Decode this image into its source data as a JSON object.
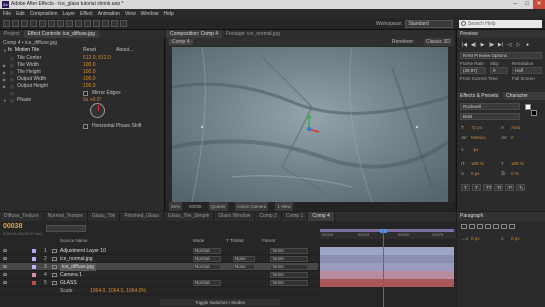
{
  "window": {
    "title": "Adobe After Effects - Ice_glass tutorial shrink.aep *",
    "app_icon": "Ae"
  },
  "menu": [
    "File",
    "Edit",
    "Composition",
    "Layer",
    "Effect",
    "Animation",
    "View",
    "Window",
    "Help"
  ],
  "toolbar": {
    "workspace_label": "Workspace:",
    "workspace_value": "Standard",
    "search_placeholder": "Search Help"
  },
  "left_tabs": [
    "Project",
    "Effect Controls: ice_diffuse.jpg"
  ],
  "effect_controls": {
    "breadcrumb": "Comp 4 • ice_diffuse.jpg",
    "effect_name": "Motion Tile",
    "reset": "Reset",
    "about": "About...",
    "rows": [
      {
        "name": "Tile Center",
        "value": "512.0, 512.0"
      },
      {
        "name": "Tile Width",
        "value": "100.0"
      },
      {
        "name": "Tile Height",
        "value": "100.0"
      },
      {
        "name": "Output Width",
        "value": "100.0"
      },
      {
        "name": "Output Height",
        "value": "100.0"
      },
      {
        "name": "Mirror Edges",
        "value": ""
      },
      {
        "name": "Phase",
        "value": "0x +0.0°"
      },
      {
        "name": "Horizontal Phase Shift",
        "value": ""
      }
    ]
  },
  "comp_tabs": [
    "Composition: Comp 4",
    "Footage: ice_normal.jpg"
  ],
  "comp": {
    "sub_tab": "Comp 4",
    "renderer_label": "Renderer:",
    "renderer_value": "Classic 3D",
    "footer": [
      "25%",
      "00038",
      "Quarter",
      "Active Camera",
      "1 View"
    ]
  },
  "right_panel": {
    "preview_title": "Preview",
    "transport": [
      "|◀",
      "◀|",
      "▶",
      "|▶",
      "▶|",
      "◁",
      "▷",
      "●"
    ],
    "ram_options": "RAM Preview Options",
    "frame_rate": "Frame Rate",
    "skip": "Skip",
    "resolution": "Resolution",
    "fps_value": "(29.97)",
    "skip_value": "0",
    "res_value": "Half",
    "from_current": "From Current Time",
    "full_screen": "Full Screen",
    "effects_title": "Effects & Presets",
    "char_title": "Character",
    "font": "Rockwell",
    "style": "Bold",
    "size": "72 px",
    "leading": "Auto",
    "kerning": "Metrics",
    "tracking": "0",
    "stroke": "- px",
    "v_scale": "100 %",
    "h_scale": "100 %",
    "baseline": "0 px",
    "tsume": "0 %"
  },
  "timeline": {
    "tabs": [
      "Diffuse_Texture",
      "Normal_Texture",
      "Glass_Tile",
      "Finished_Glass",
      "Glass_Tile_Simple",
      "Glass Window",
      "Comp 2",
      "Comp 1",
      "Comp 4"
    ],
    "time": "00038",
    "time_sub": "0:00:01:08 (29.97 fps)",
    "columns": {
      "source": "Source Name",
      "mode": "Mode",
      "trk": "T  TrkMat",
      "parent": "Parent"
    },
    "ruler": [
      "00000",
      "00025",
      "00050",
      "00075"
    ],
    "layers": [
      {
        "num": "1",
        "name": "Adjustment Layer 10",
        "label": "#a7a7ff",
        "mode": "Normal",
        "trk": "",
        "parent": "None",
        "bar": "#9ea4c4"
      },
      {
        "num": "2",
        "name": "ice_normal.jpg",
        "label": "#b3b3ff",
        "mode": "Normal",
        "trk": "None",
        "parent": "None",
        "bar": "#8c8fb3"
      },
      {
        "num": "3",
        "name": "ice_diffuse.jpg",
        "label": "#b3b3ff",
        "mode": "Normal",
        "trk": "None",
        "parent": "None",
        "bar": "#9a9dc0",
        "selected": true
      },
      {
        "num": "4",
        "name": "Camera 1",
        "label": "#e08ca8",
        "mode": "",
        "trk": "",
        "parent": "None",
        "bar": "#b78c9d"
      },
      {
        "num": "5",
        "name": "GLASS",
        "label": "#c04a4a",
        "mode": "Normal",
        "trk": "",
        "parent": "None",
        "bar": "#a95858"
      }
    ],
    "scale_label": "Scale",
    "scale_value": "1064.0, 1064.0, 1064.0%",
    "toggle": "Toggle Switches / Modes"
  },
  "paragraph": {
    "title": "Paragraph",
    "indent": "0 px",
    "space": "0 px"
  }
}
